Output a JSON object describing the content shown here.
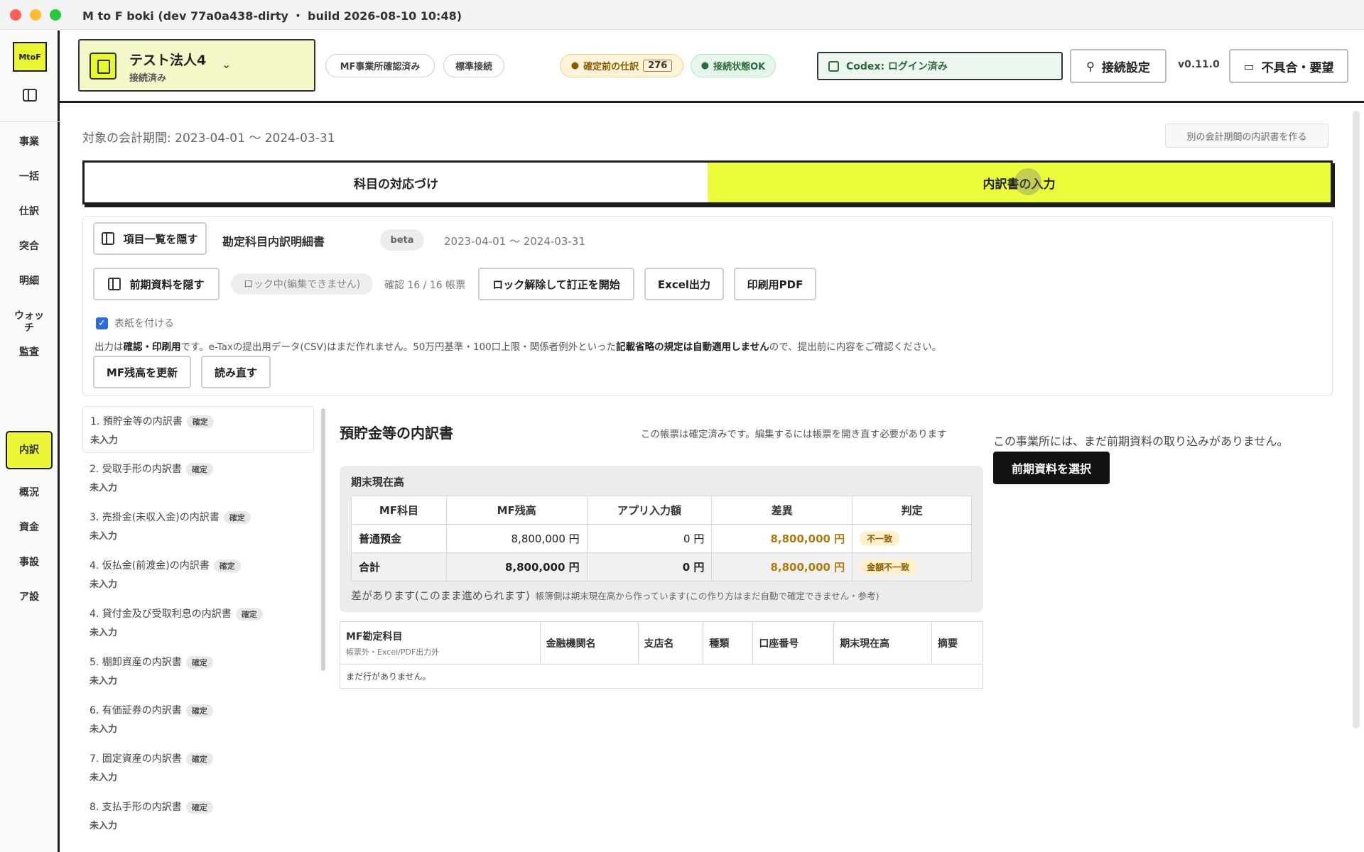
{
  "window": {
    "title": "M to F boki (dev 77a0a438-dirty ・ build 2026-08-10 10:48)"
  },
  "rail": {
    "logo": "MtoF",
    "items": [
      "事業",
      "一括",
      "仕訳",
      "突合",
      "明細",
      "ウォッチ",
      "監査",
      "内訳",
      "概況",
      "資金",
      "事設",
      "ア設"
    ],
    "active_index": 7
  },
  "header": {
    "company_name": "テスト法人4",
    "company_status": "接続済み",
    "pill_office": "MF事業所確認済み",
    "pill_standard": "標準接続",
    "pending_label": "確定前の仕訳",
    "pending_count": "276",
    "connection": "接続状態OK",
    "codex": "Codex: ログイン済み",
    "settings_label": "接続設定",
    "version": "v0.11.0",
    "feedback_label": "不具合・要望"
  },
  "main": {
    "period": "対象の会計期間: 2023-04-01 〜 2024-03-31",
    "other_period": "別の会計期間の内訳書を作る",
    "tabs": [
      "科目の対応づけ",
      "内訳書の入力"
    ],
    "active_tab": 1
  },
  "panel": {
    "hide_list": "項目一覧を隠す",
    "doc_title": "勘定科目内訳明細書",
    "beta": "beta",
    "doc_period": "2023-04-01 〜 2024-03-31",
    "hide_prev": "前期資料を隠す",
    "lock_status": "ロック中(編集できません)",
    "confirm_count": "確認 16 / 16 帳票",
    "unlock_btn": "ロック解除して訂正を開始",
    "excel_btn": "Excel出力",
    "pdf_btn": "印刷用PDF",
    "cover_label": "表紙を付ける",
    "cover_checked": true,
    "note_a": "出力は",
    "note_b": "確認・印刷用",
    "note_c": "です。e-Taxの提出用データ(CSV)はまだ作れません。50万円基準・100口上限・関係者例外といった",
    "note_d": "記載省略の規定は自動適用しません",
    "note_e": "ので、提出前に内容をご確認ください。",
    "refresh_btn": "MF残高を更新",
    "reload_btn": "読み直す"
  },
  "list": [
    {
      "title": "1. 預貯金等の内訳書",
      "badge": "確定",
      "status": "未入力"
    },
    {
      "title": "2. 受取手形の内訳書",
      "badge": "確定",
      "status": "未入力"
    },
    {
      "title": "3. 売掛金(未収入金)の内訳書",
      "badge": "確定",
      "status": "未入力"
    },
    {
      "title": "4. 仮払金(前渡金)の内訳書",
      "badge": "確定",
      "status": "未入力"
    },
    {
      "title": "4. 貸付金及び受取利息の内訳書",
      "badge": "確定",
      "status": "未入力"
    },
    {
      "title": "5. 棚卸資産の内訳書",
      "badge": "確定",
      "status": "未入力"
    },
    {
      "title": "6. 有価証券の内訳書",
      "badge": "確定",
      "status": "未入力"
    },
    {
      "title": "7. 固定資産の内訳書",
      "badge": "確定",
      "status": "未入力"
    },
    {
      "title": "8. 支払手形の内訳書",
      "badge": "確定",
      "status": "未入力"
    }
  ],
  "content": {
    "title": "預貯金等の内訳書",
    "locked_note": "この帳票は確定済みです。編集するには帳票を開き直す必要があります",
    "prev_note": "この事業所には、まだ前期資料の取り込みがありません。",
    "prev_btn": "前期資料を選択",
    "balance_title": "期末現在高",
    "balance_headers": [
      "MF科目",
      "MF残高",
      "アプリ入力額",
      "差異",
      "判定"
    ],
    "balance_rows": [
      {
        "account": "普通預金",
        "mf": "8,800,000 円",
        "app": "0 円",
        "diff": "8,800,000 円",
        "judge": "不一致"
      },
      {
        "account": "合計",
        "mf": "8,800,000 円",
        "app": "0 円",
        "diff": "8,800,000 円",
        "judge": "金額不一致"
      }
    ],
    "balance_foot": "差があります(このまま進められます)",
    "balance_foot_sub": "帳簿側は期末現在高から作っています(この作り方はまだ自動で確定できません・参考)",
    "detail_headers": [
      "MF勘定科目",
      "金融機関名",
      "支店名",
      "種類",
      "口座番号",
      "期末現在高",
      "摘要"
    ],
    "detail_header_sub": "帳票外・Excel/PDF出力外",
    "detail_empty": "まだ行がありません。"
  }
}
